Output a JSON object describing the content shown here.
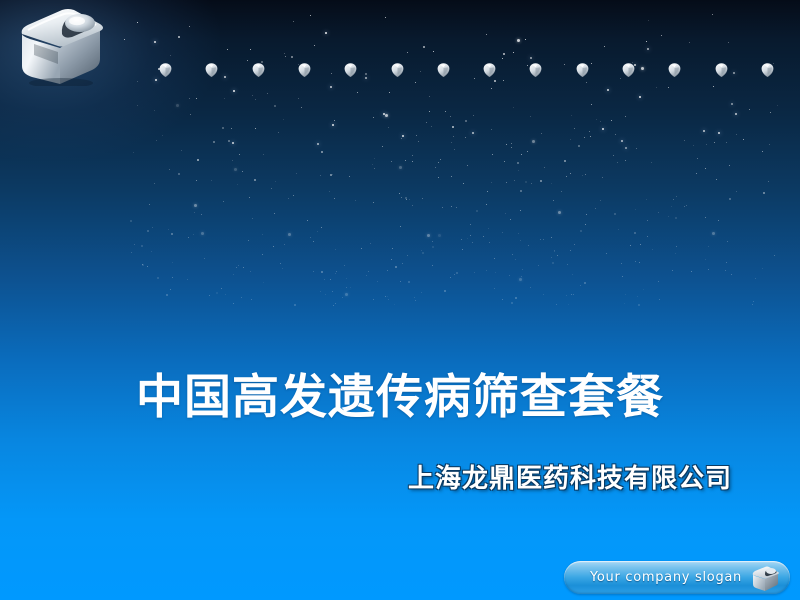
{
  "slide": {
    "title": "中国高发遗传病筛查套餐",
    "subtitle": "上海龙鼎医药科技有限公司",
    "slogan": "Your company  slogan",
    "logo_icon": "chrome-cube-logo-icon",
    "slogan_logo_icon": "chrome-cube-small-icon",
    "gem_icon": "silver-gem-icon",
    "gem_count": 14,
    "colors": {
      "background_top": "#050c18",
      "background_mid": "#0d5291",
      "background_bottom": "#0099ff",
      "title_text": "#ffffff",
      "subtitle_text": "#ffffff",
      "subtitle_outline": "#0a3a63",
      "slogan_text": "#ffffff",
      "pill_light": "#a9d9f5",
      "pill_dark": "#1b8fd8",
      "gem_silver": "#e8edf2"
    }
  }
}
